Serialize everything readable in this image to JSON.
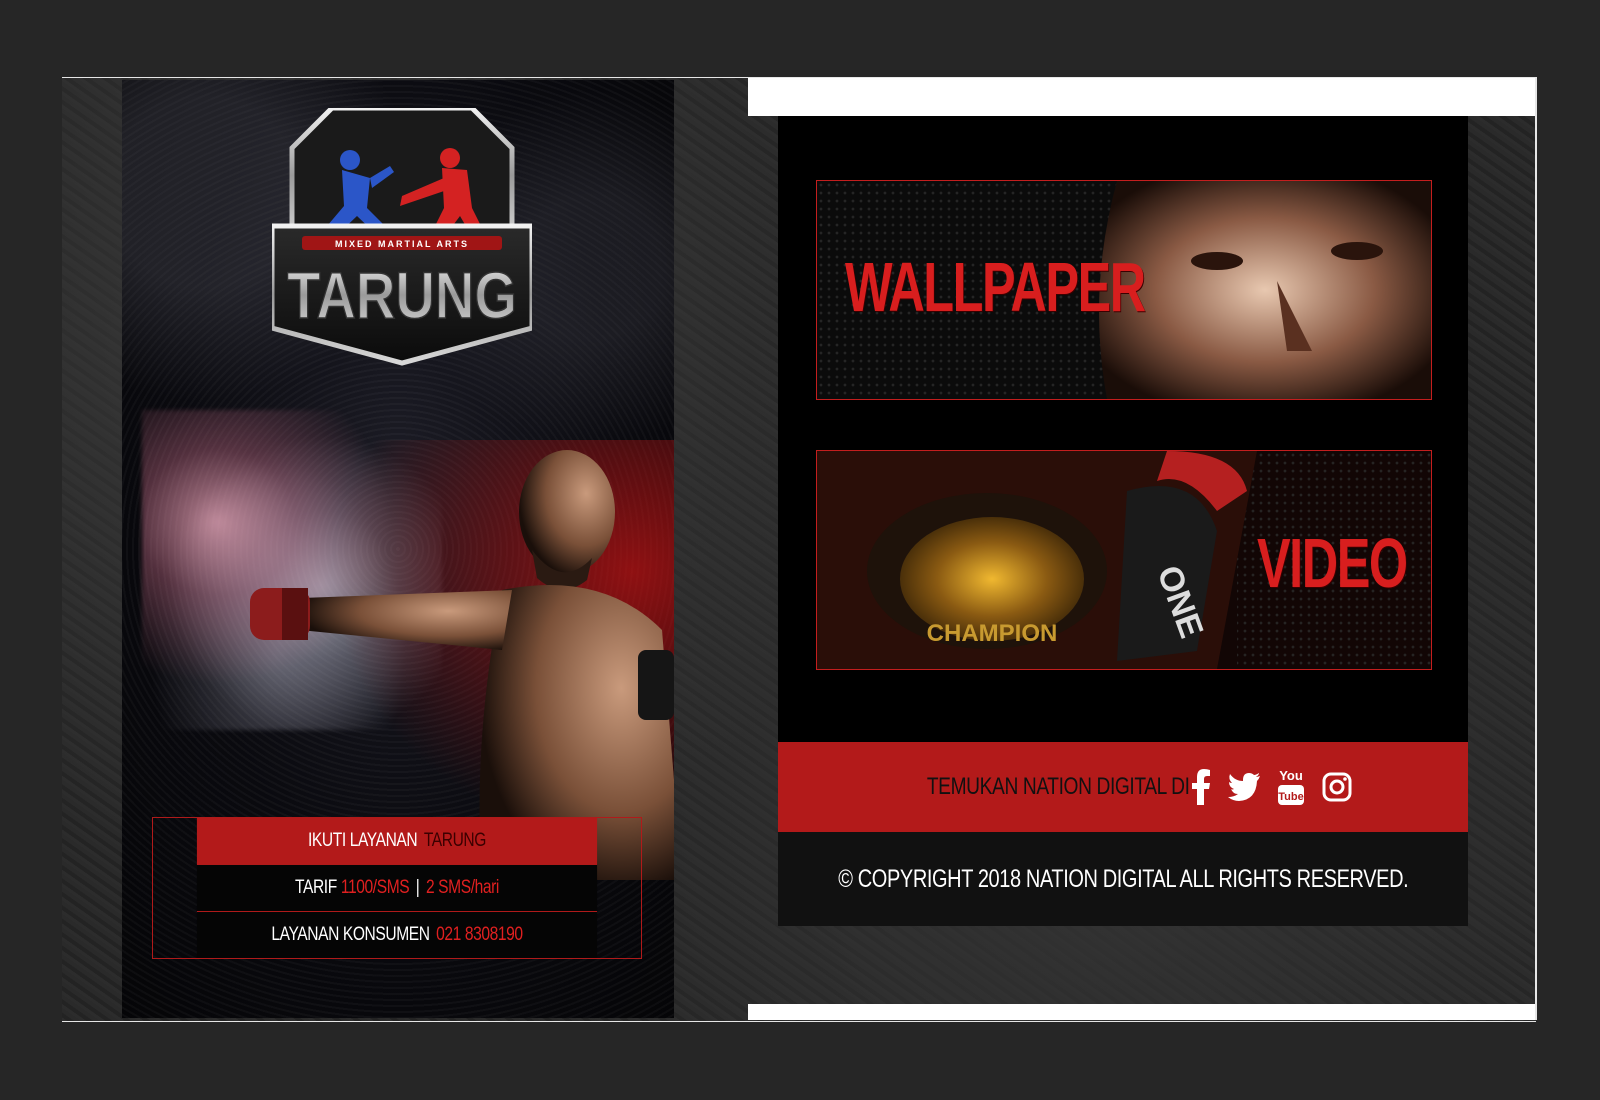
{
  "logo": {
    "subtitle": "MIXED MARTIAL ARTS",
    "title": "TARUNG"
  },
  "service": {
    "header_prefix": "IKUTI LAYANAN",
    "header_brand": "TARUNG",
    "tariff_label": "TARIF",
    "tariff_price": "1100/SMS",
    "tariff_sep": "|",
    "tariff_limit": "2 SMS/hari",
    "cs_label": "LAYANAN KONSUMEN",
    "cs_phone": "021 8308190"
  },
  "banners": {
    "wallpaper_label": "WALLPAPER",
    "video_label": "VIDEO",
    "belt_text": "CHAMPION",
    "glove_text": "ONE"
  },
  "footer": {
    "find_text": "TEMUKAN NATION DIGITAL DI",
    "social_icons": [
      "facebook-icon",
      "twitter-icon",
      "youtube-icon",
      "instagram-icon"
    ],
    "youtube_you": "You",
    "youtube_tube": "Tube",
    "copyright": "© COPYRIGHT 2018 NATION DIGITAL ALL RIGHTS RESERVED."
  },
  "colors": {
    "accent_red": "#b31a1a",
    "text_red": "#e02020",
    "background": "#262626"
  }
}
